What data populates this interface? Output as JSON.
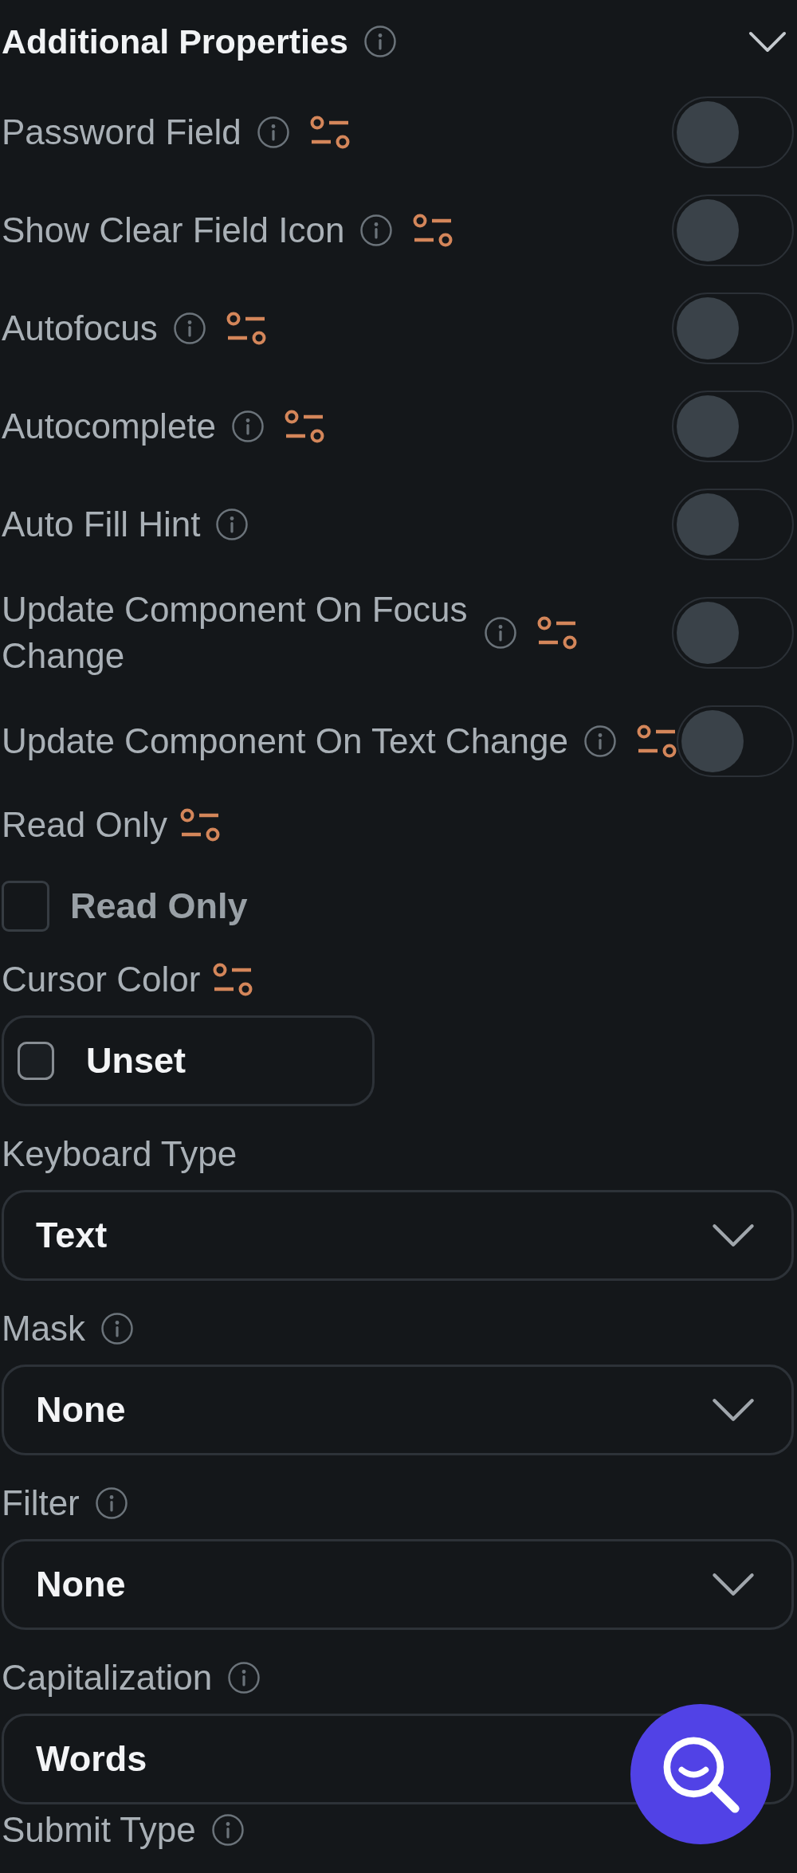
{
  "section": {
    "title": "Additional Properties",
    "info_icon": true,
    "expanded": true
  },
  "properties": [
    {
      "kind": "toggle",
      "label": "Password Field",
      "info_icon": true,
      "variable_icon": true,
      "on": false
    },
    {
      "kind": "toggle",
      "label": "Show Clear Field Icon",
      "info_icon": true,
      "variable_icon": true,
      "on": false
    },
    {
      "kind": "toggle",
      "label": "Autofocus",
      "info_icon": true,
      "variable_icon": true,
      "on": false
    },
    {
      "kind": "toggle",
      "label": "Autocomplete",
      "info_icon": true,
      "variable_icon": true,
      "on": false
    },
    {
      "kind": "toggle",
      "label": "Auto Fill Hint",
      "info_icon": true,
      "variable_icon": false,
      "on": false
    },
    {
      "kind": "toggle",
      "label": "Update Component On Focus Change",
      "info_icon": true,
      "variable_icon": true,
      "on": false
    },
    {
      "kind": "toggle",
      "label": "Update Component On Text Change",
      "info_icon": true,
      "variable_icon": true,
      "on": false
    },
    {
      "kind": "checkbox",
      "label": "Read Only",
      "info_icon": false,
      "variable_icon": true,
      "checkbox_label": "Read Only",
      "checked": false
    },
    {
      "kind": "color",
      "label": "Cursor Color",
      "info_icon": false,
      "variable_icon": true,
      "value": "Unset"
    },
    {
      "kind": "dropdown",
      "label": "Keyboard Type",
      "info_icon": false,
      "variable_icon": false,
      "value": "Text"
    },
    {
      "kind": "dropdown",
      "label": "Mask",
      "info_icon": true,
      "variable_icon": false,
      "value": "None"
    },
    {
      "kind": "dropdown",
      "label": "Filter",
      "info_icon": true,
      "variable_icon": false,
      "value": "None"
    },
    {
      "kind": "dropdown",
      "label": "Capitalization",
      "info_icon": true,
      "variable_icon": false,
      "value": "Words"
    },
    {
      "kind": "dropdown",
      "label": "Submit Type",
      "info_icon": true,
      "variable_icon": false
    }
  ]
}
